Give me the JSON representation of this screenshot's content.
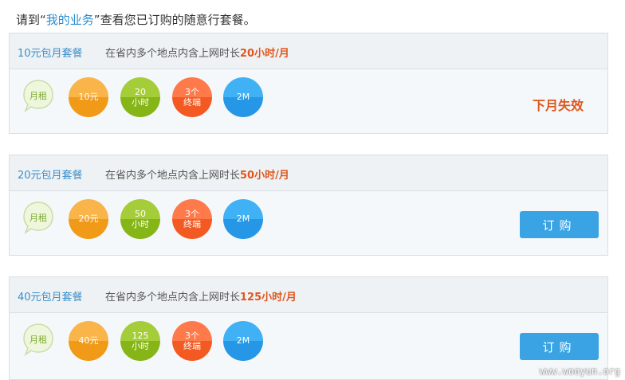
{
  "intro": {
    "prefix": "请到“",
    "link": "我的业务",
    "suffix": "”查看您已订购的随意行套餐。"
  },
  "plans": [
    {
      "title": "10元包月套餐",
      "desc_prefix": "在省内多个地点内含上网时长",
      "desc_hours": "20小时/月",
      "rent": "月租",
      "price": "10元",
      "hours_num": "20",
      "hours_unit": "小时",
      "term_num": "3个",
      "term_unit": "终端",
      "speed": "2M",
      "status": "下月失效"
    },
    {
      "title": "20元包月套餐",
      "desc_prefix": "在省内多个地点内含上网时长",
      "desc_hours": "50小时/月",
      "rent": "月租",
      "price": "20元",
      "hours_num": "50",
      "hours_unit": "小时",
      "term_num": "3个",
      "term_unit": "终端",
      "speed": "2M",
      "button": "订购"
    },
    {
      "title": "40元包月套餐",
      "desc_prefix": "在省内多个地点内含上网时长",
      "desc_hours": "125小时/月",
      "rent": "月租",
      "price": "40元",
      "hours_num": "125",
      "hours_unit": "小时",
      "term_num": "3个",
      "term_unit": "终端",
      "speed": "2M",
      "button": "订购"
    }
  ],
  "watermark": "www.wooyun.org"
}
